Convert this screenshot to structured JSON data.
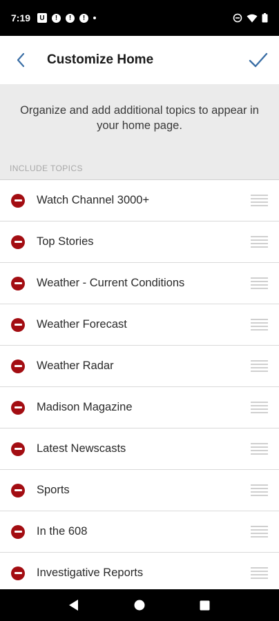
{
  "status_bar": {
    "time": "7:19",
    "notifications": [
      {
        "icon": "u-app-icon",
        "text": "U"
      },
      {
        "icon": "alert-icon",
        "text": "!"
      },
      {
        "icon": "alert-icon",
        "text": "!"
      },
      {
        "icon": "alert-icon",
        "text": "!"
      }
    ],
    "right_icons": [
      "do-not-disturb-icon",
      "wifi-icon",
      "battery-icon"
    ]
  },
  "header": {
    "back_icon": "back-chevron-icon",
    "title": "Customize Home",
    "save_icon": "checkmark-icon"
  },
  "description": "Organize and add additional topics to appear in your home page.",
  "section_label": "INCLUDE TOPICS",
  "topics": [
    {
      "label": "Watch Channel 3000+"
    },
    {
      "label": "Top Stories"
    },
    {
      "label": "Weather - Current Conditions"
    },
    {
      "label": "Weather Forecast"
    },
    {
      "label": "Weather Radar"
    },
    {
      "label": "Madison Magazine"
    },
    {
      "label": "Latest Newscasts"
    },
    {
      "label": "Sports"
    },
    {
      "label": "In the 608"
    },
    {
      "label": "Investigative Reports"
    }
  ],
  "colors": {
    "accent": "#3a6ea5",
    "remove": "#a30d12",
    "panel": "#ebebeb"
  },
  "nav_bar": [
    "back-triangle-icon",
    "home-circle-icon",
    "recents-square-icon"
  ]
}
